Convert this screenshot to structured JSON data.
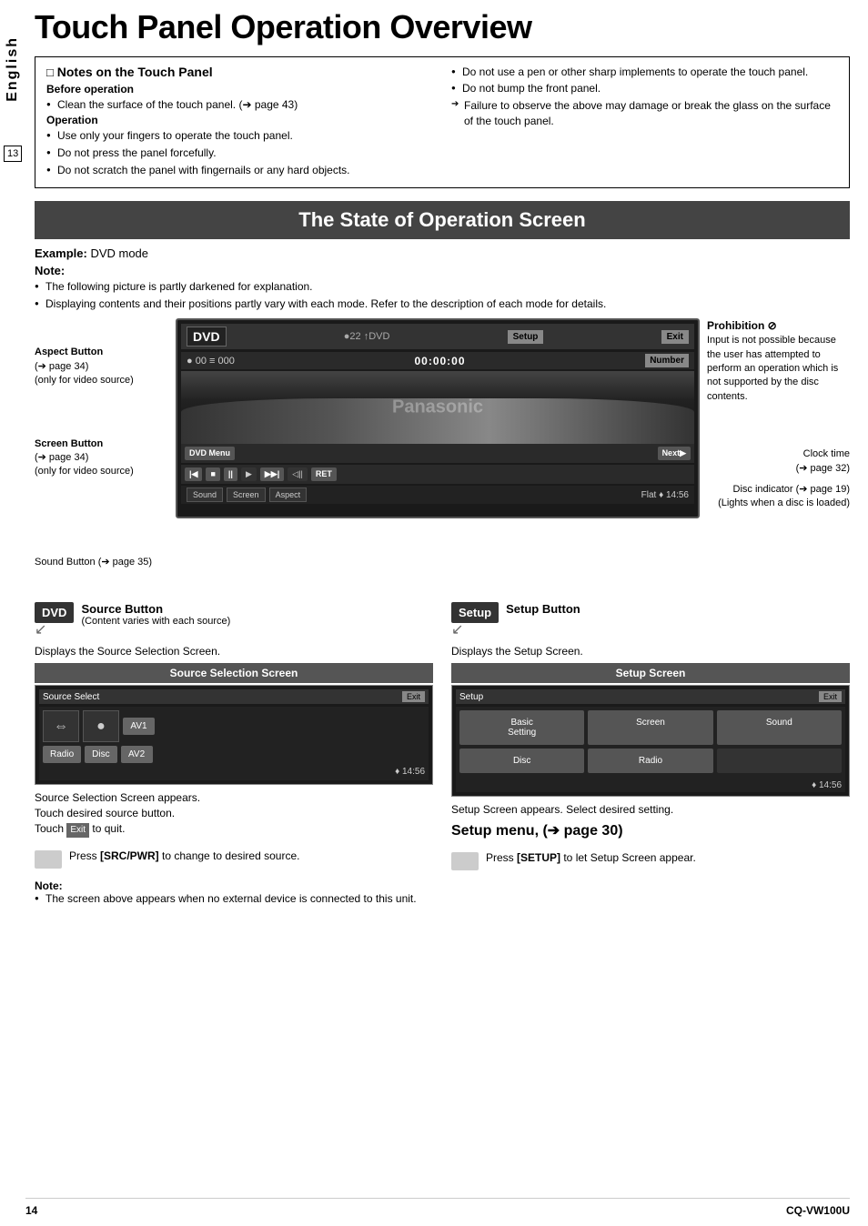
{
  "page": {
    "title": "Touch Panel Operation Overview",
    "sidebar_label": "English",
    "page_number": "13",
    "footer_left": "14",
    "footer_right": "CQ-VW100U"
  },
  "notes_panel": {
    "title": "Notes on the Touch Panel",
    "before_op_title": "Before operation",
    "before_op_items": [
      "Clean the surface of the touch panel.  (➔ page 43)"
    ],
    "operation_title": "Operation",
    "operation_items": [
      "Use only your fingers to operate the touch panel.",
      "Do not press the panel forcefully.",
      "Do not scratch the panel with fingernails or any hard objects."
    ],
    "right_items": [
      "Do not use a pen or other sharp implements to operate the touch panel.",
      "Do not bump the front panel."
    ],
    "right_arrow": "Failure to observe the above may damage or break the glass on the surface of the touch panel."
  },
  "section": {
    "header": "The State of Operation Screen",
    "example_label": "Example:",
    "example_value": "DVD mode",
    "note_title": "Note:",
    "note_items": [
      "The following picture is partly darkened for explanation.",
      "Displaying contents and their positions partly vary with each mode. Refer to the description of each mode for details."
    ]
  },
  "dvd_screen": {
    "dvd_label": "DVD",
    "icons_text": "●22  ↑DVD",
    "setup_btn": "Setup",
    "exit_btn": "Exit",
    "second_row": "● 00  ≡ 000",
    "time": "00:00:00",
    "number_btn": "Number",
    "dvd_menu_btn": "DVD Menu",
    "next_btn": "Next▶",
    "rew_btn": "|◀",
    "stop_btn": "■",
    "pause_btn": "||",
    "play_btn": "▶",
    "ff_btn": "▶▶|",
    "slow_btn": "◁||",
    "ret_btn": "RET",
    "sound_btn": "Sound",
    "screen_btn": "Screen",
    "aspect_btn": "Aspect",
    "flat_text": "Flat",
    "clock_time": "14:56"
  },
  "labels": {
    "aspect_button_title": "Aspect Button",
    "aspect_button_ref": "(➔ page 34)",
    "aspect_button_note": "(only for video source)",
    "screen_button_title": "Screen Button",
    "screen_button_ref": "(➔ page 34)",
    "screen_button_note": "(only for video source)",
    "sound_button": "Sound Button (➔ page 35)"
  },
  "prohibition": {
    "title": "Prohibition ⊘",
    "text": "Input is not possible because the user has attempted to perform an operation which is not supported by the disc contents."
  },
  "clock_note": {
    "text": "Clock time",
    "ref": "(➔ page 32)"
  },
  "disc_note": {
    "text": "Disc indicator (➔ page 19)",
    "sub": "(Lights when a disc is loaded)"
  },
  "bottom": {
    "source_button_title": "Source Button",
    "source_button_sub": "(Content varies with each source)",
    "setup_button_title": "Setup Button",
    "displays_source": "Displays the Source Selection Screen.",
    "displays_setup": "Displays the Setup Screen.",
    "source_screen_label": "Source Selection Screen",
    "setup_screen_label": "Setup Screen",
    "source_select_title": "Source Select",
    "exit_label": "Exit",
    "radio_label": "Radio",
    "disc_label": "Disc",
    "av1_label": "AV1",
    "av2_label": "AV2",
    "setup_label": "Setup",
    "basic_setting": "Basic\nSetting",
    "screen_label": "Screen",
    "sound_label": "Sound",
    "disc_setting": "Disc",
    "radio_setting": "Radio",
    "appears_source": "Source Selection Screen appears.\nTouch desired source button.\nTouch",
    "exit_btn_label": "Exit",
    "to_quit": "to quit.",
    "appears_setup": "Setup Screen appears. Select desired setting.",
    "setup_menu": "Setup menu, (➔ page 30)",
    "press_src_text": "Press [SRC/PWR] to change to desired source.",
    "press_setup_text": "Press [SETUP] to let Setup Screen appear.",
    "note_title": "Note:",
    "note_item": "The screen above appears when no external device is connected to this unit."
  }
}
